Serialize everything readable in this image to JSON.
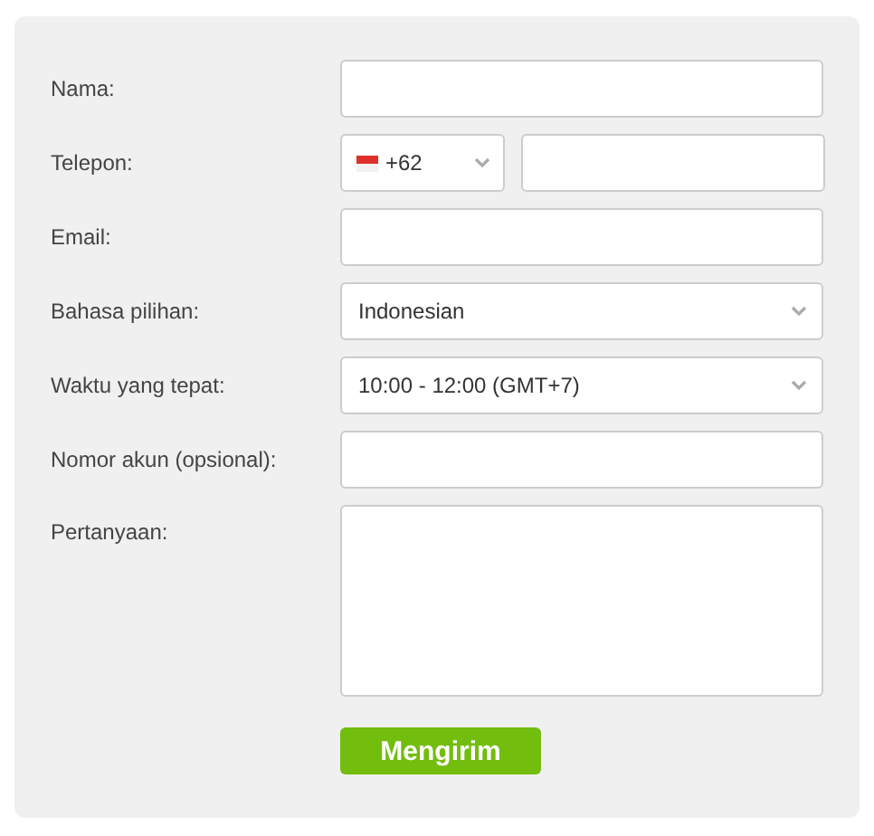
{
  "form": {
    "fields": [
      {
        "kind": "text",
        "label": "Nama:"
      },
      {
        "kind": "phone",
        "label": "Telepon:",
        "code": "+62"
      },
      {
        "kind": "text",
        "label": "Email:"
      },
      {
        "kind": "select",
        "label": "Bahasa pilihan:",
        "value": "Indonesian"
      },
      {
        "kind": "select",
        "label": "Waktu yang tepat:",
        "value": "10:00 - 12:00 (GMT+7)"
      },
      {
        "kind": "text",
        "label": "Nomor akun (opsional):"
      },
      {
        "kind": "textarea",
        "label": "Pertanyaan:"
      }
    ],
    "submit": "Mengirim"
  }
}
